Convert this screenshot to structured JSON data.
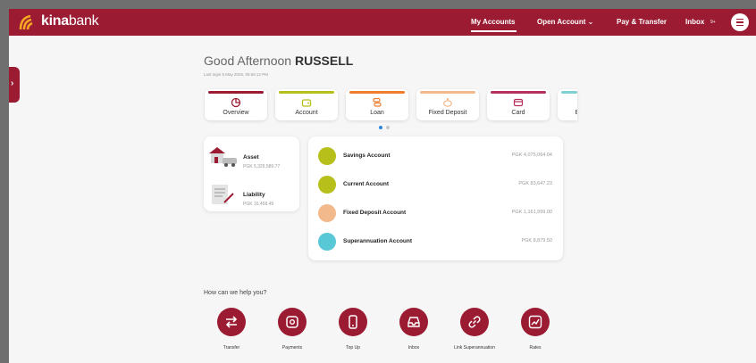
{
  "header": {
    "brand_bold": "kina",
    "brand_light": "bank",
    "nav": [
      {
        "label": "My Accounts"
      },
      {
        "label": "Open Account ⌄"
      },
      {
        "label": "Pay & Transfer"
      },
      {
        "label": "Inbox"
      }
    ],
    "inbox_badge": "9+",
    "brand_color": "#9a1b32"
  },
  "greeting": {
    "prefix": "Good Afternoon",
    "name": "RUSSELL",
    "last_login": "Last login 5 May 2025, 05:56:12 PM"
  },
  "tiles": [
    {
      "label": "Overview",
      "color": "#9a1b32",
      "icon": "pie-chart-icon"
    },
    {
      "label": "Account",
      "color": "#b7bf1a",
      "icon": "wallet-icon"
    },
    {
      "label": "Loan",
      "color": "#ef7d2d",
      "icon": "coins-icon"
    },
    {
      "label": "Fixed Deposit",
      "color": "#f2b98c",
      "icon": "piggy-bank-icon"
    },
    {
      "label": "Card",
      "color": "#b5315c",
      "icon": "card-icon"
    },
    {
      "label": "E",
      "color": "#7fd0d0",
      "icon": "partial-tile-icon"
    }
  ],
  "pager": {
    "active": 0,
    "total": 2
  },
  "summary": [
    {
      "title": "Asset",
      "value": "PGK 5,329,589.77",
      "icon": "house-car-icon"
    },
    {
      "title": "Liability",
      "value": "PGK 16,458.49",
      "icon": "document-icon"
    }
  ],
  "accounts": [
    {
      "name": "Savings Account",
      "balance": "PGK 4,075,064.04",
      "color": "#b7bf1a",
      "icon": "wallet-icon"
    },
    {
      "name": "Current Account",
      "balance": "PGK 83,647.23",
      "color": "#b7bf1a",
      "icon": "wallet-icon"
    },
    {
      "name": "Fixed Deposit Account",
      "balance": "PGK 1,161,999.00",
      "color": "#f2b98c",
      "icon": "piggy-bank-icon"
    },
    {
      "name": "Superannuation Account",
      "balance": "PGK 8,879.50",
      "color": "#58c7d6",
      "icon": "link-icon"
    }
  ],
  "help": {
    "title": "How can we help you?",
    "services": [
      {
        "label": "Transfer",
        "icon": "transfer-icon"
      },
      {
        "label": "Payments",
        "icon": "payments-icon"
      },
      {
        "label": "Top Up",
        "icon": "phone-icon"
      },
      {
        "label": "Inbox",
        "icon": "inbox-icon"
      },
      {
        "label": "Link Superannuation",
        "icon": "link-icon"
      },
      {
        "label": "Rates",
        "icon": "chart-icon"
      }
    ]
  }
}
